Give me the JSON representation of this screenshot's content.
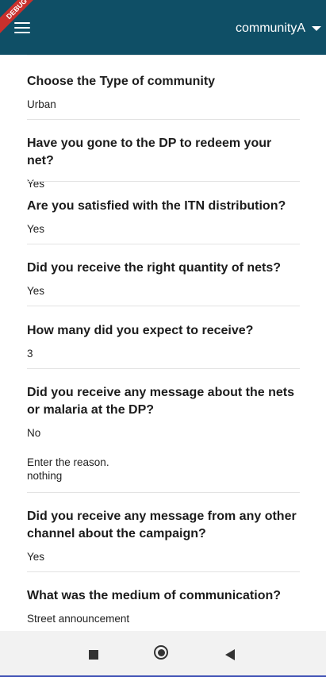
{
  "app_bar": {
    "debug_banner": "DEBUG",
    "menu_icon": "hamburger-menu-icon",
    "community_selector": {
      "selected": "communityA",
      "icon": "caret-down-icon"
    },
    "background_color": "#0f4f66"
  },
  "form_items": [
    {
      "question": "Choose the Type of community",
      "answer": "Urban"
    },
    {
      "question": "Have you gone to the DP to redeem your net?",
      "answer": "Yes"
    },
    {
      "question": "Are you satisfied with the ITN distribution?",
      "answer": "Yes"
    },
    {
      "question": "Did you receive the right quantity of nets?",
      "answer": "Yes"
    },
    {
      "question": "How many did you expect to receive?",
      "answer": "3"
    },
    {
      "question": "Did you receive any message about the nets or malaria at the DP?",
      "answer": "No",
      "sub_label": "Enter the reason.",
      "sub_answer": "nothing"
    },
    {
      "question": "Did you receive any message from any other channel about the campaign?",
      "answer": "Yes"
    },
    {
      "question": "What was the medium of communication?",
      "answer": "Street announcement"
    }
  ],
  "nav_bar": {
    "recent_icon": "square-recents-icon",
    "home_icon": "circle-home-icon",
    "back_icon": "triangle-back-icon",
    "accent_color": "#3f51b5"
  }
}
